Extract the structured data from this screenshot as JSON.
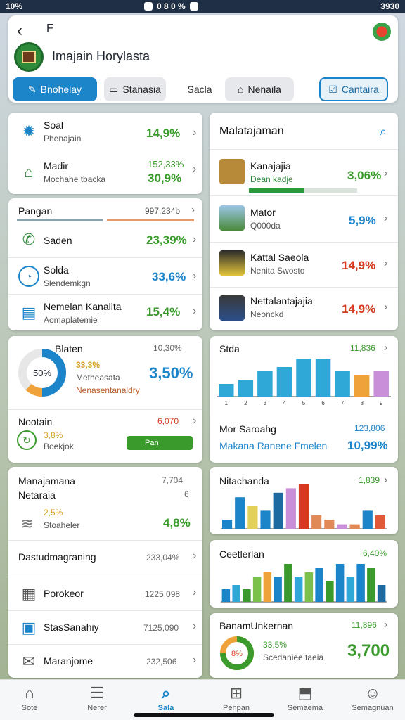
{
  "status": {
    "left": "10%",
    "center": "0 8 0 %",
    "right": "3930"
  },
  "header": {
    "back_icon": "arrow-left-icon",
    "small_title": "F",
    "app_title": "Imajain Horylasta"
  },
  "tabs": [
    {
      "label": "Bnohelay",
      "icon": "pencil-icon"
    },
    {
      "label": "Stanasia",
      "icon": "doc-icon"
    },
    {
      "label": "Sacla"
    },
    {
      "label": "Nenaila",
      "icon": "lock-icon"
    },
    {
      "label": "Cantaira",
      "icon": "edit-icon"
    }
  ],
  "left": {
    "card1": [
      {
        "title": "Soal",
        "sub": "Phenajain",
        "value": "14,9%"
      },
      {
        "title": "Madir",
        "sub": "Mochahe tbacka",
        "value_top": "152,33%",
        "value": "30,9%"
      }
    ],
    "card2": {
      "header": {
        "title": "Pangan",
        "value": "997,234b"
      },
      "rows": [
        {
          "title": "Saden",
          "value": "23,39%"
        },
        {
          "title": "Solda",
          "sub": "Slendemkgn",
          "value": "33,6%"
        },
        {
          "title": "Nemelan Kanalita",
          "sub": "Aomaplatemie",
          "value": "15,4%"
        }
      ]
    },
    "donut": {
      "label": "Blaten",
      "center": "50%",
      "percent_small": "33,3%",
      "sub1": "Metheasata",
      "sub2": "Nenasentanaldry",
      "value_top": "10,30%",
      "value": "3,50%",
      "fraction": 0.5
    },
    "nootain": {
      "title": "Nootain",
      "small": "3,8%",
      "sub": "Boekjok",
      "value": "6,070",
      "button": "Pan"
    },
    "mana": {
      "title": "Manajamana",
      "sub": "Netaraia",
      "small": "2,5%",
      "sub2": "Stoaheler",
      "value_top": "7,704",
      "value_mid": "6",
      "value": "4,8%"
    },
    "list": [
      {
        "title": "Dastudmagraning",
        "value": "233,04%"
      },
      {
        "title": "Porokeor",
        "value": "1225,098"
      },
      {
        "title": "StasSanahiy",
        "value": "7125,090"
      },
      {
        "title": "Maranjome",
        "value": "232,506"
      }
    ]
  },
  "right": {
    "card1": {
      "title": "Malatajaman",
      "rows": [
        {
          "title": "Kanajajia",
          "sub": "Dean kadje",
          "value": "3,06%"
        },
        {
          "title": "Mator",
          "sub": "Q000da",
          "value": "5,9%"
        },
        {
          "title": "Kattal Saeola",
          "sub": "Nenita Swosto",
          "value": "14,9%"
        },
        {
          "title": "Nettalantajajia",
          "sub": "Neonckd",
          "value": "14,9%"
        }
      ]
    },
    "chart1": {
      "title": "Stda",
      "value": "11,836",
      "sub1": "Mor Saroahg",
      "sub1_value": "123,806",
      "sub2": "Makana Ranene Fmelen",
      "sub2_value": "10,99%"
    },
    "chart2": {
      "title": "Nitachanda",
      "value": "1,839"
    },
    "chart3": {
      "title": "Ceetlerlan",
      "value": "6,40%"
    },
    "donut": {
      "title": "BanamUnkernan",
      "value_top": "11,896",
      "center": "8%",
      "small": "33,5%",
      "sub": "Scedaniee taeia",
      "value": "3,700",
      "fraction": 0.75
    }
  },
  "chart_data": [
    {
      "type": "bar",
      "categories": [
        "1",
        "2",
        "3",
        "4",
        "5",
        "6",
        "7",
        "8",
        "9"
      ],
      "values": [
        3,
        4,
        6,
        7,
        9,
        9,
        6,
        5,
        6
      ],
      "xlabel": "",
      "ylabel": ""
    },
    {
      "type": "bar",
      "values": [
        2,
        7,
        5,
        4,
        8,
        9,
        10,
        3,
        2,
        1,
        1,
        4,
        3
      ],
      "xlabel": "",
      "ylabel": ""
    },
    {
      "type": "bar",
      "values": [
        3,
        4,
        3,
        6,
        7,
        6,
        9,
        6,
        7,
        8,
        5,
        9,
        6,
        9,
        8,
        4
      ],
      "xlabel": "",
      "ylabel": ""
    }
  ],
  "bottom_nav": [
    {
      "label": "Sote",
      "icon": "home-icon"
    },
    {
      "label": "Nerer",
      "icon": "list-icon"
    },
    {
      "label": "Sala",
      "icon": "search-icon",
      "active": true
    },
    {
      "label": "Penpan",
      "icon": "grid-icon"
    },
    {
      "label": "Semaema",
      "icon": "bag-icon"
    },
    {
      "label": "Semagnuan",
      "icon": "user-icon"
    }
  ],
  "colors": {
    "accent": "#1c84c9",
    "positive": "#3a9b2c",
    "negative": "#d63a1f"
  }
}
